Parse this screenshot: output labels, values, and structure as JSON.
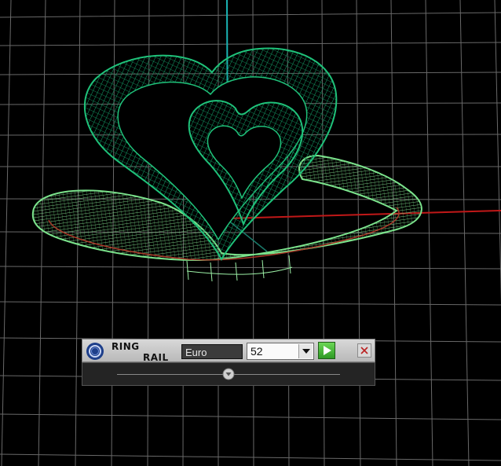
{
  "panel": {
    "title_line1": "RING",
    "title_line2": "RAIL",
    "unit_value": "Euro",
    "size_value": "52",
    "slider_value": 0.5
  },
  "icons": {
    "logo": "ring-logo-icon",
    "dropdown": "chevron-down-icon",
    "run": "play-icon",
    "close": "close-icon",
    "slider": "slider-thumb-icon"
  },
  "colors": {
    "wire_green": "#1fc27a",
    "rail_green": "#7be38c",
    "x_axis": "#c01818",
    "y_axis": "#1ab3b3",
    "grid": "#8a8a8a",
    "run_button": "#3fbf2e"
  }
}
